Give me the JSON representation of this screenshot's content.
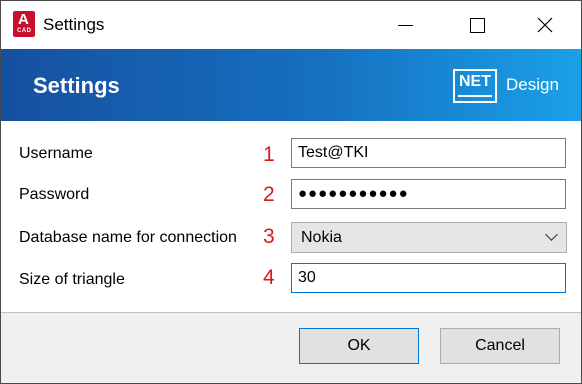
{
  "window": {
    "title": "Settings",
    "app_icon": {
      "icon": "autocad-app-icon",
      "letter": "A",
      "sub": "CAD",
      "color": "#c8102e"
    }
  },
  "controls": {
    "minimize": "minimize-icon",
    "maximize": "maximize-icon",
    "close": "close-icon",
    "close_glyph": "✕"
  },
  "banner": {
    "title": "Settings",
    "logo_text": "NET",
    "logo_suffix": "Design",
    "gradient": [
      "#1650a0",
      "#1aa0e8"
    ]
  },
  "form": {
    "username": {
      "label": "Username",
      "number": "1",
      "value": "Test@TKI"
    },
    "password": {
      "label": "Password",
      "number": "2",
      "value": "●●●●●●●●●●●"
    },
    "database": {
      "label": "Database name for connection",
      "number": "3",
      "selected": "Nokia"
    },
    "triangle": {
      "label": "Size of triangle",
      "number": "4",
      "value": "30"
    },
    "number_color": "#d81b1b"
  },
  "buttons": {
    "ok": "OK",
    "cancel": "Cancel"
  }
}
